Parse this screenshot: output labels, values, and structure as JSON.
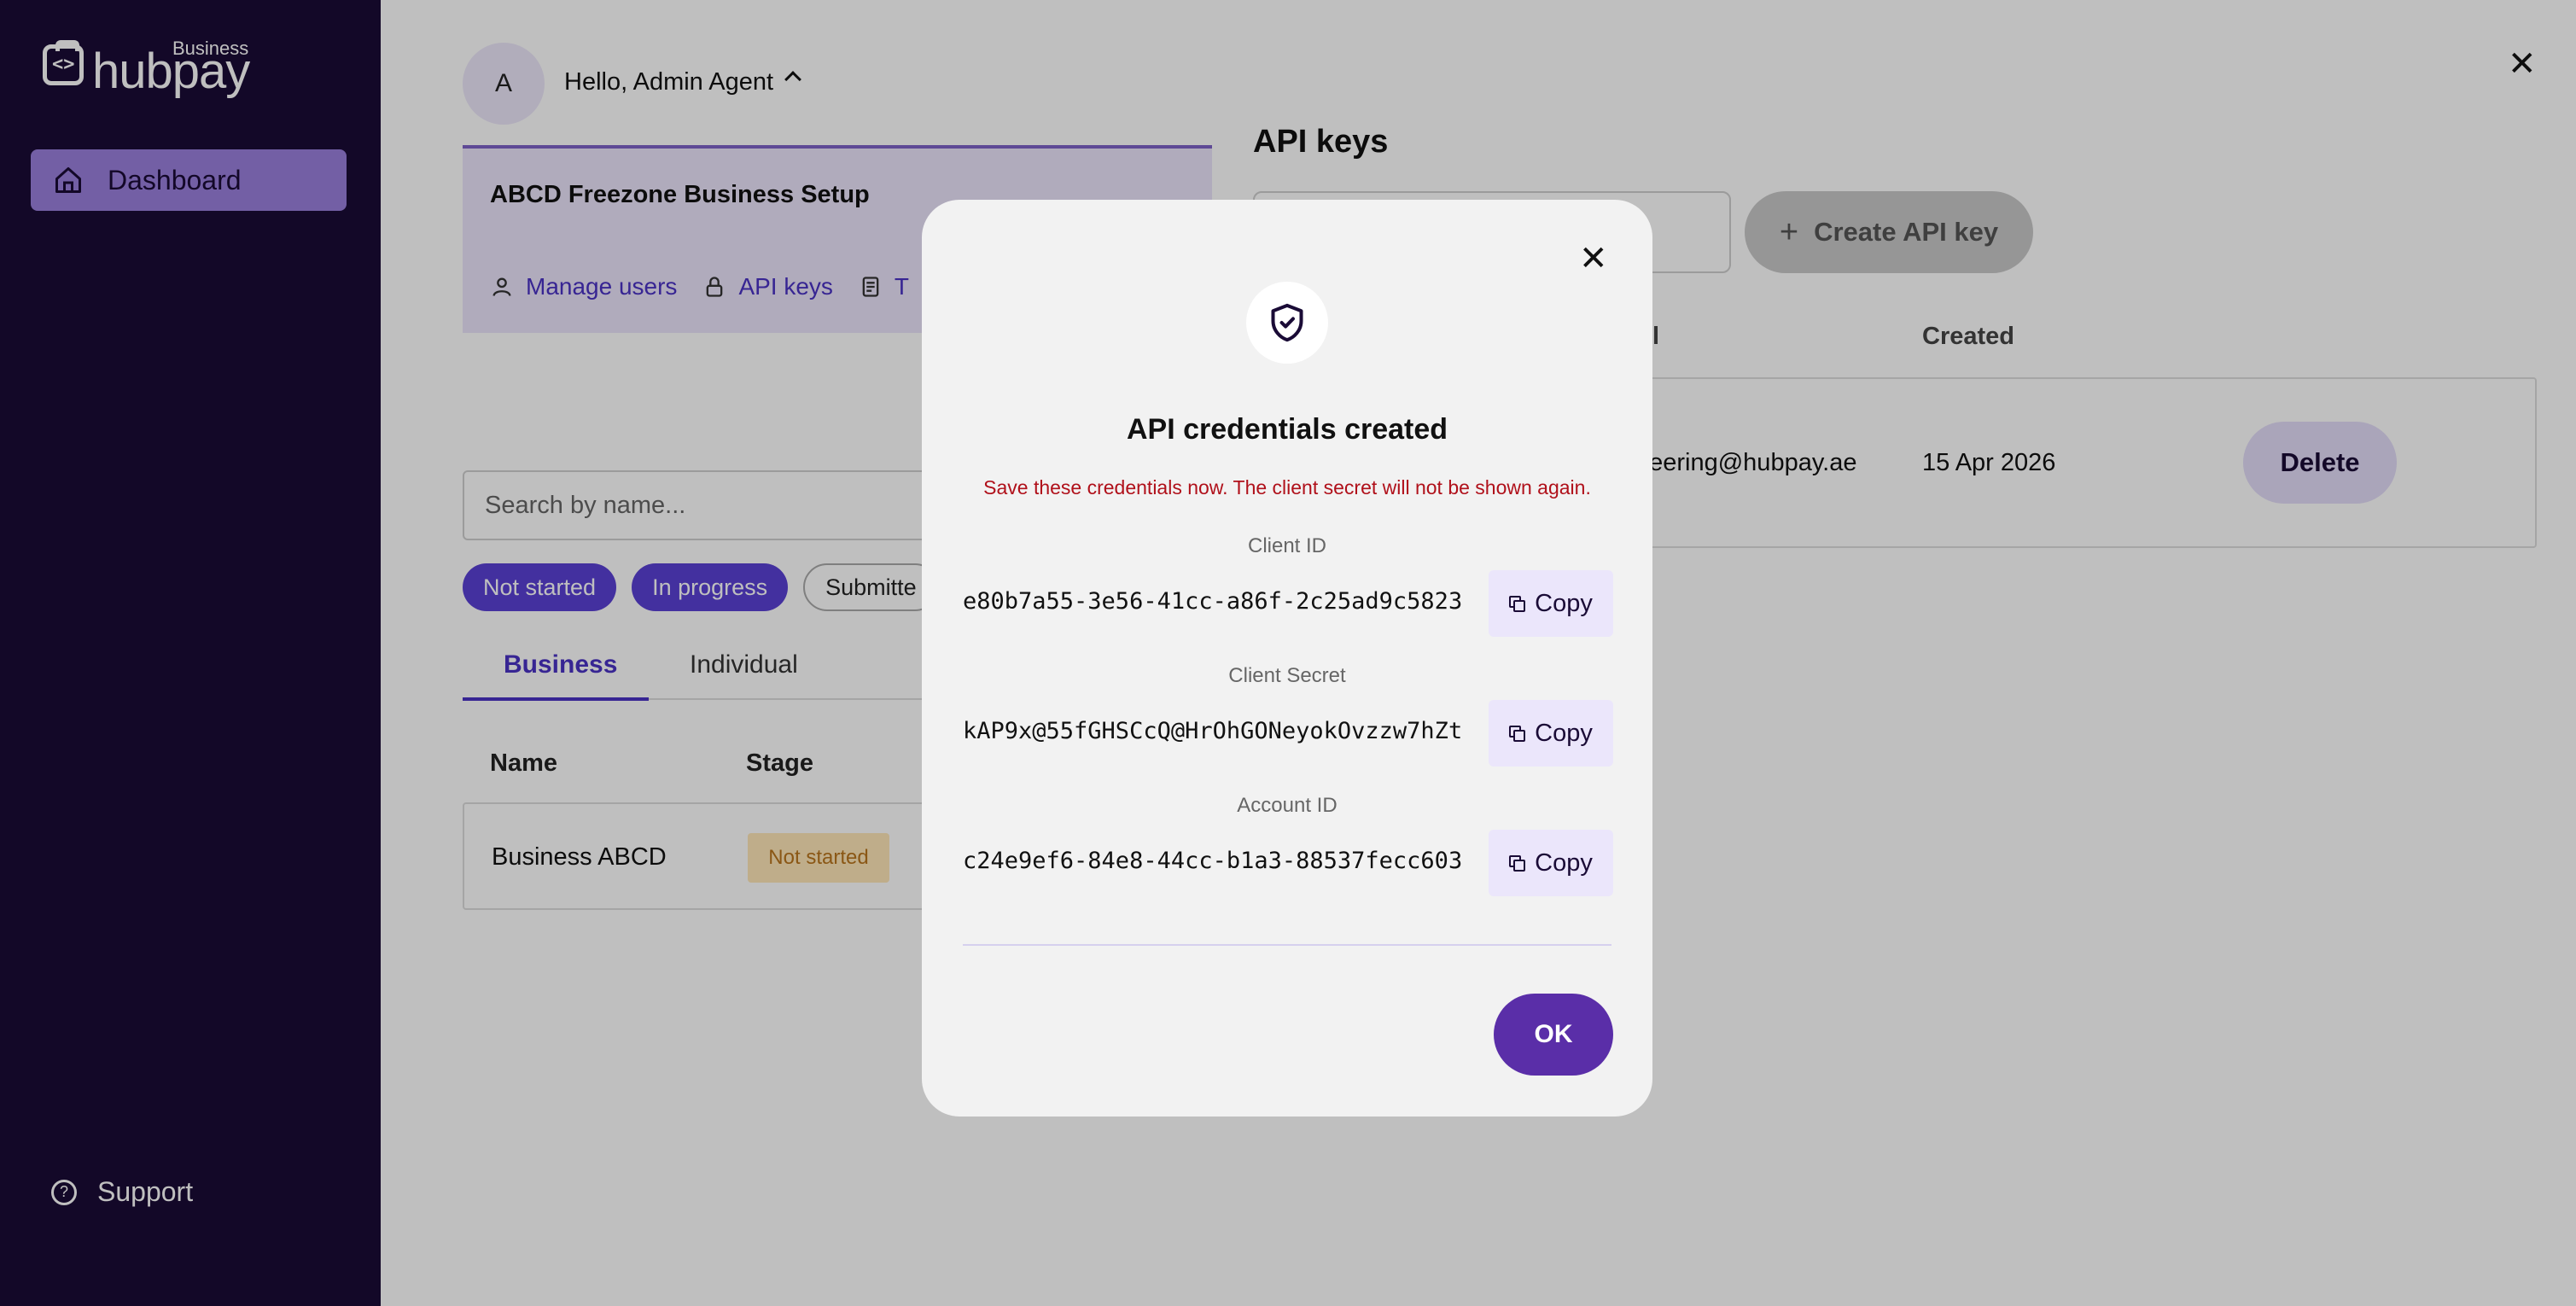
{
  "brand": {
    "logo_text": "hubpay",
    "logo_superscript": "Business"
  },
  "sidebar": {
    "items": [
      {
        "label": "Dashboard",
        "icon": "home-icon",
        "active": true
      }
    ],
    "support_label": "Support",
    "active_color": "#9a7fdc",
    "background_color": "#1a0b36"
  },
  "header": {
    "avatar_initial": "A",
    "greeting": "Hello, Admin Agent"
  },
  "org_card": {
    "title": "ABCD Freezone Business Setup",
    "links": [
      {
        "label": "Manage users",
        "icon": "user-icon"
      },
      {
        "label": "API keys",
        "icon": "lock-icon"
      },
      {
        "label": "T",
        "icon": "document-icon"
      }
    ]
  },
  "search": {
    "placeholder": "Search by name..."
  },
  "filters": {
    "chips": [
      {
        "label": "Not started",
        "active": true
      },
      {
        "label": "In progress",
        "active": true
      },
      {
        "label": "Submitte",
        "active": false
      }
    ]
  },
  "tabs": [
    {
      "label": "Business",
      "active": true
    },
    {
      "label": "Individual",
      "active": false
    }
  ],
  "table": {
    "columns": [
      "Name",
      "Stage"
    ],
    "rows": [
      {
        "name": "Business ABCD",
        "stage": "Not started"
      }
    ]
  },
  "api_panel": {
    "title": "API keys",
    "create_button": "Create API key",
    "columns": [
      "il",
      "Created"
    ],
    "rows": [
      {
        "email": "neering@hubpay.ae",
        "created": "15 Apr 2026",
        "action": "Delete"
      }
    ]
  },
  "modal": {
    "title": "API credentials created",
    "warning": "Save these credentials now. The client secret will not be shown again.",
    "credentials": [
      {
        "label": "Client ID",
        "value": "e80b7a55-3e56-41cc-a86f-2c25ad9c5823",
        "copy_label": "Copy"
      },
      {
        "label": "Client Secret",
        "value": "kAP9x@55fGHSCcQ@HrOhGONeyokOvzzw7hZt",
        "copy_label": "Copy"
      },
      {
        "label": "Account ID",
        "value": "c24e9ef6-84e8-44cc-b1a3-88537fecc603",
        "copy_label": "Copy"
      }
    ],
    "ok_label": "OK",
    "accent_color": "#5a2ea8",
    "warning_color": "#b0101a"
  }
}
